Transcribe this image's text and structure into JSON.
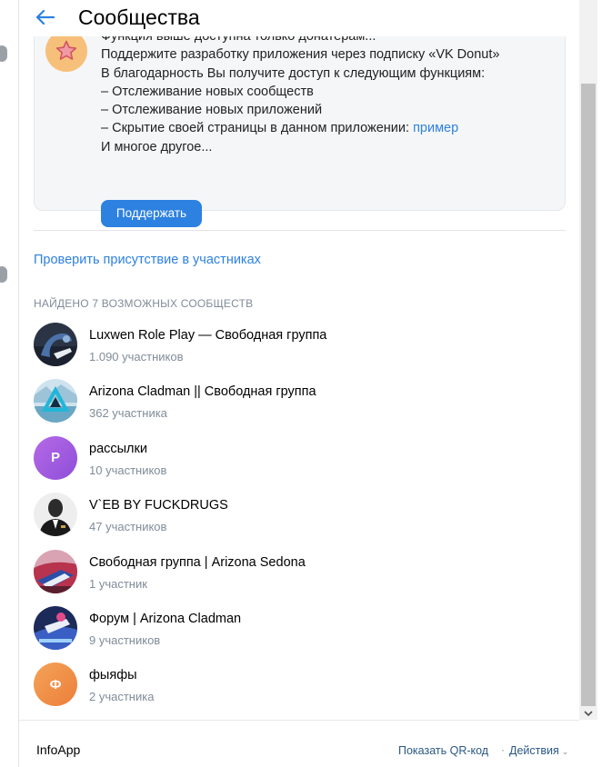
{
  "header": {
    "title": "Сообщества",
    "back_icon": "arrow-left-icon"
  },
  "donut_card": {
    "icon": "star-icon",
    "lines": [
      "Функция выше доступна только донатерам...",
      "Поддержите разработку приложения через подписку «VK Donut»",
      "В благодарность Вы получите доступ к следующим функциям:",
      "– Отслеживание новых сообществ",
      "– Отслеживание новых приложений",
      "– Скрытие своей страницы в данном приложении: ",
      "И многое другое..."
    ],
    "example_link": "пример",
    "button_label": "Поддержать"
  },
  "check_link": "Проверить присутствие в участниках",
  "found_header": "НАЙДЕНО 7 ВОЗМОЖНЫХ СООБЩЕСТВ",
  "communities": [
    {
      "name": "Luxwen Role Play — Свободная группа",
      "members": "1.090 участников",
      "avatar": "photo"
    },
    {
      "name": "Arizona Cladman || Свободная группа",
      "members": "362 участника",
      "avatar": "photo"
    },
    {
      "name": "рассылки",
      "members": "10 участников",
      "avatar_letter": "Р"
    },
    {
      "name": "V`EB BY FUCKDRUGS",
      "members": "47 участников",
      "avatar": "photo"
    },
    {
      "name": "Свободная группа | Arizona Sedona",
      "members": "1 участник",
      "avatar": "photo"
    },
    {
      "name": "Форум | Arizona Cladman",
      "members": "9 участников",
      "avatar": "photo"
    },
    {
      "name": "фыяфы",
      "members": "2 участника",
      "avatar_letter": "Ф"
    }
  ],
  "footer": {
    "app_name": "InfoApp",
    "qr_link": "Показать QR-код",
    "separator": "·",
    "actions": "Действия"
  },
  "colors": {
    "accent": "#2d81e0",
    "link": "#2a5885",
    "muted": "#818c99",
    "card_bg": "#f5f6f8"
  }
}
